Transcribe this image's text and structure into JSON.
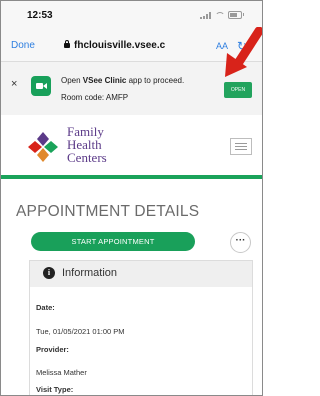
{
  "status_bar": {
    "time": "12:53"
  },
  "browser": {
    "done_label": "Done",
    "url": "fhclouisville.vsee.c",
    "aa_label": "AA"
  },
  "app_banner": {
    "line1_prefix": "Open ",
    "line1_app": "VSee Clinic",
    "line1_suffix": " app to proceed.",
    "line2": "Room code: AMFP",
    "open_label": "OPEN",
    "close_glyph": "×"
  },
  "site_header": {
    "logo_line1": "Family",
    "logo_line2": "Health",
    "logo_line3": "Centers"
  },
  "page": {
    "title": "APPOINTMENT DETAILS",
    "start_button": "START APPOINTMENT",
    "more_glyph": "···"
  },
  "info_card": {
    "title": "Information",
    "date_label": "Date:",
    "date_value": "Tue, 01/05/2021 01:00 PM",
    "provider_label": "Provider:",
    "provider_value": "Melissa Mather",
    "visit_type_label": "Visit Type:"
  },
  "colors": {
    "accent_green": "#1aa35a",
    "link_blue": "#2f7fe0",
    "brand_purple": "#5b3a88",
    "annotation_red": "#d8231a"
  }
}
